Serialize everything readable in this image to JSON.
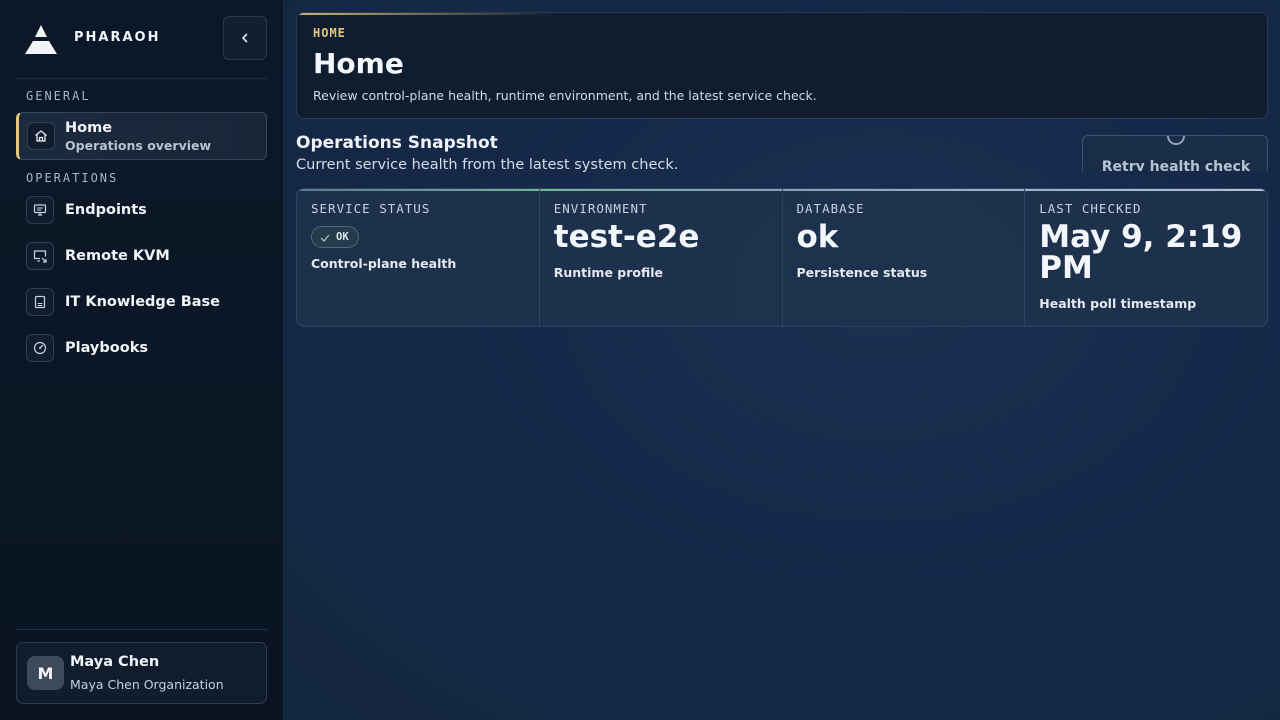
{
  "brand": {
    "name": "PHARAOH"
  },
  "sidebar": {
    "general_label": "GENERAL",
    "operations_label": "OPERATIONS",
    "home": {
      "label": "Home",
      "sub": "Operations overview"
    },
    "items": [
      {
        "label": "Endpoints",
        "icon": "monitor-icon"
      },
      {
        "label": "Remote KVM",
        "icon": "remote-screen-icon"
      },
      {
        "label": "IT Knowledge Base",
        "icon": "book-icon"
      },
      {
        "label": "Playbooks",
        "icon": "gauge-icon"
      }
    ],
    "accent": "#e6c77a"
  },
  "user": {
    "initial": "M",
    "name": "Maya Chen",
    "org": "Maya Chen Organization"
  },
  "header": {
    "crumb": "HOME",
    "title": "Home",
    "description": "Review control-plane health, runtime environment, and the latest service check."
  },
  "snapshot": {
    "title": "Operations Snapshot",
    "description": "Current service health from the latest system check.",
    "retry_label": "Retry health check"
  },
  "stats": {
    "status": {
      "label": "SERVICE STATUS",
      "badge": "OK",
      "caption": "Control-plane health"
    },
    "environment": {
      "label": "ENVIRONMENT",
      "value": "test-e2e",
      "caption": "Runtime profile"
    },
    "database": {
      "label": "DATABASE",
      "value": "ok",
      "caption": "Persistence status"
    },
    "checked": {
      "label": "LAST CHECKED",
      "value": "May 9, 2:19 PM",
      "caption": "Health poll timestamp"
    }
  }
}
